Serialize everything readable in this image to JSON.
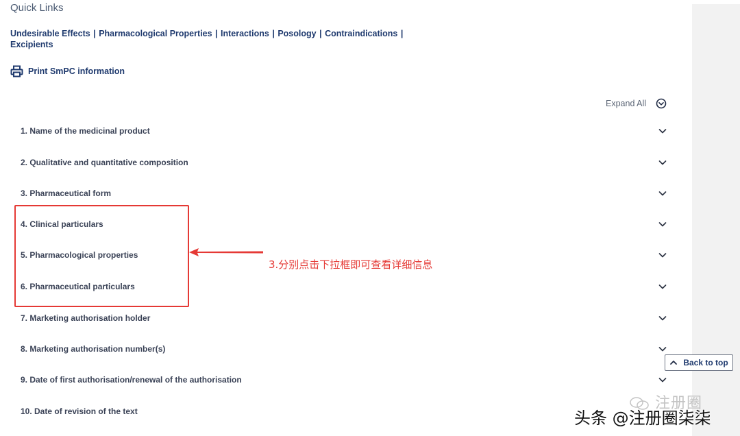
{
  "quick_links": {
    "title": "Quick Links",
    "links": [
      "Undesirable Effects",
      "Pharmacological Properties",
      "Interactions",
      "Posology",
      "Contraindications",
      "Excipients"
    ],
    "separator": "|"
  },
  "print": {
    "label": "Print SmPC information",
    "icon": "printer-icon"
  },
  "expand_all": {
    "label": "Expand All",
    "icon": "circle-chevron-down-icon"
  },
  "sections": [
    {
      "label": "1. Name of the medicinal product"
    },
    {
      "label": "2. Qualitative and quantitative composition"
    },
    {
      "label": "3. Pharmaceutical form"
    },
    {
      "label": "4. Clinical particulars"
    },
    {
      "label": "5. Pharmacological properties"
    },
    {
      "label": "6. Pharmaceutical particulars"
    },
    {
      "label": "7. Marketing authorisation holder"
    },
    {
      "label": "8. Marketing authorisation number(s)"
    },
    {
      "label": "9. Date of first authorisation/renewal of the authorisation"
    },
    {
      "label": "10. Date of revision of the text"
    }
  ],
  "annotation": {
    "text": "3.分别点击下拉框即可查看详细信息",
    "color": "#e53935"
  },
  "back_to_top": {
    "label": "Back to top",
    "icon": "chevron-up-icon"
  },
  "watermark": {
    "logo_text": "注册圈",
    "text": "头条 @注册圈柒柒"
  },
  "colors": {
    "link": "#1f3a6e",
    "section_text": "#3a4256",
    "annotation": "#e53935"
  }
}
